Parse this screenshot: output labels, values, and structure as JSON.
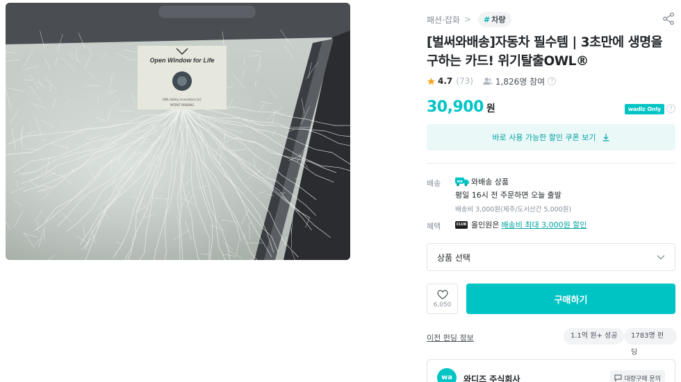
{
  "image": {
    "sticker_text": "Open Window for Life",
    "sticker_small_1": "OWL Safety Innovations LLC",
    "sticker_small_2": "PATENT PENDING"
  },
  "breadcrumb": {
    "category": "패션·잡화",
    "separator": ">",
    "tag_hash": "#",
    "tag": "차량"
  },
  "title": "[벌써와배송]자동차 필수템 | 3초만에 생명을 구하는 카드! 위기탈출OWL®",
  "rating": {
    "score": "4.7",
    "count": "(73)",
    "participants": "1,826명 참여",
    "help": "?"
  },
  "price": {
    "amount": "30,900",
    "unit": "원",
    "badge": "wadiz Only",
    "info": "?"
  },
  "coupon": {
    "label": "바로 사용 가능한 할인 쿠폰 보기"
  },
  "shipping": {
    "label": "배송",
    "badge": "wa",
    "type": "와배송 상품",
    "desc": "평일 16시 전 주문하면 오늘 출발",
    "fee": "배송비 3,000원(제주/도서산간 5,000원)"
  },
  "benefit": {
    "label": "혜택",
    "club": "CLUB",
    "prefix": "올인원은",
    "link": "배송비 최대 3,000원 할인"
  },
  "select": {
    "placeholder": "상품 선택"
  },
  "actions": {
    "like_count": "6,050",
    "buy": "구매하기"
  },
  "history": {
    "link": "이전 펀딩 정보",
    "chips": [
      "1.1억 원+ 성공",
      "1783명 펀딩"
    ]
  },
  "maker": {
    "logo": "wa",
    "name": "와디즈 주식회사",
    "bulk_inquiry": "대량구매 문의"
  },
  "colors": {
    "accent": "#00c4c4",
    "coupon_bg": "#ebf8f8",
    "star": "#f5a623"
  }
}
